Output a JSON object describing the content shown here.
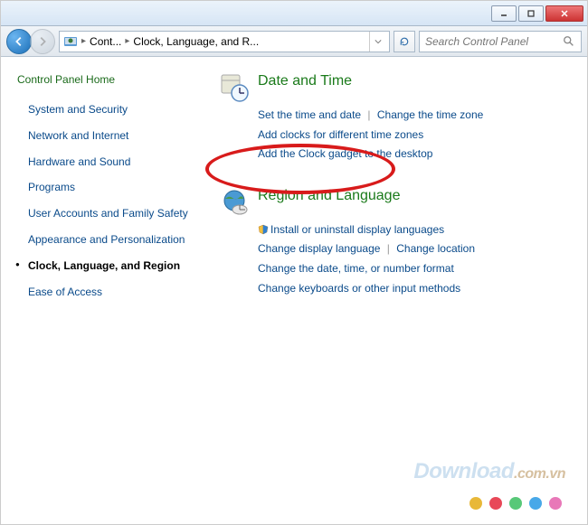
{
  "breadcrumb": {
    "item1": "Cont...",
    "item2": "Clock, Language, and R..."
  },
  "search": {
    "placeholder": "Search Control Panel"
  },
  "sidebar": {
    "home": "Control Panel Home",
    "items": [
      "System and Security",
      "Network and Internet",
      "Hardware and Sound",
      "Programs",
      "User Accounts and Family Safety",
      "Appearance and Personalization",
      "Clock, Language, and Region",
      "Ease of Access"
    ]
  },
  "sections": {
    "date_time": {
      "title": "Date and Time",
      "links": [
        "Set the time and date",
        "Change the time zone",
        "Add clocks for different time zones",
        "Add the Clock gadget to the desktop"
      ]
    },
    "region_lang": {
      "title": "Region and Language",
      "shield_link": "Install or uninstall display languages",
      "links": [
        "Change display language",
        "Change location",
        "Change the date, time, or number format",
        "Change keyboards or other input methods"
      ]
    }
  },
  "watermark": {
    "main": "Download",
    "suffix": ".com.vn"
  },
  "dots": [
    "#e8b838",
    "#e84858",
    "#58c878",
    "#48a8e8",
    "#e878b8"
  ]
}
